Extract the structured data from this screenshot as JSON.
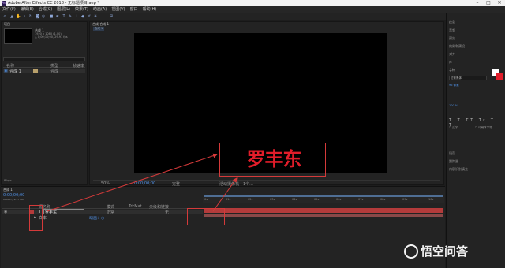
{
  "window": {
    "title": "Adobe After Effects CC 2018 - 无标题项目.aep *",
    "logo": "Ae"
  },
  "menu": [
    "文件(F)",
    "编辑(E)",
    "合成(C)",
    "图层(L)",
    "效果(T)",
    "动画(A)",
    "视图(V)",
    "窗口",
    "帮助(H)"
  ],
  "search": {
    "placeholder": "搜索帮助"
  },
  "project_panel": {
    "tab": "项目",
    "comp_name": "合成 1",
    "comp_info_1": "1920 x 1080 (1.00)",
    "comp_info_2": "△ 0;00;10;00, 29.97 fps",
    "col_name": "名称",
    "col_type": "类型",
    "col_size": "帧速率",
    "item_name": "合成 1",
    "item_type": "合成",
    "bpc": "8 bpc"
  },
  "comp_panel": {
    "tab": "合成 合成 1",
    "breadcrumb": "合成 1",
    "zoom": "50%",
    "timecode": "0;00;00;00",
    "quality": "完整",
    "camera": "活动摄像机",
    "views": "1个..."
  },
  "overlay": {
    "logo_text": "罗丰东"
  },
  "right_panel": {
    "items": [
      "信息",
      "音频",
      "预览",
      "效果和预设",
      "对齐",
      "库",
      "字符"
    ],
    "font": "仿宋黑体",
    "size": "96 像素",
    "tracking": "100 %",
    "paragraph_items": [
      "段落",
      "跟踪器",
      "内容识别填充"
    ],
    "checkbox_1": "连字",
    "checkbox_2": "印刷体字符"
  },
  "timeline": {
    "tab": "合成 1",
    "timecode": "0;00;00;00",
    "fps": "00000 (29.97 fps)",
    "col_source": "源名称",
    "col_mode": "模式",
    "col_trkmat": "TrkMat",
    "col_parent": "父级和链接",
    "layer_name": "罗丰东",
    "layer_mode": "正常",
    "layer_parent": "无",
    "sub_name": "文本",
    "sub_value": "动画：○",
    "ticks": [
      "0s",
      "01s",
      "02s",
      "03s",
      "04s",
      "05s",
      "06s",
      "07s",
      "08s",
      "09s",
      "10s"
    ]
  },
  "watermark": {
    "text": "悟空问答"
  },
  "colors": {
    "accent_red": "#d43a3a",
    "brand_red": "#e11d2a",
    "timeline_blue": "#4f8fe3"
  }
}
